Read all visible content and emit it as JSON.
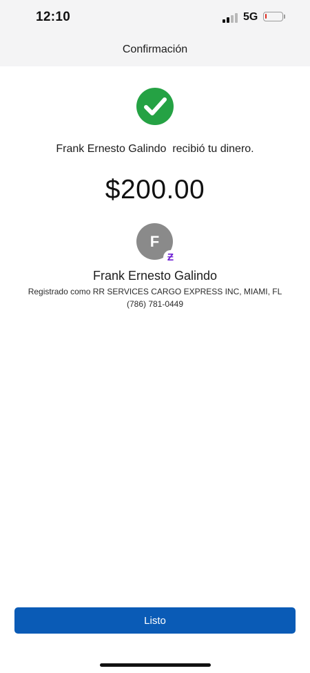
{
  "status_bar": {
    "time": "12:10",
    "network": "5G",
    "battery_level": 0.1,
    "signal_bars_active": 2,
    "battery_color": "#e0281d"
  },
  "header": {
    "title": "Confirmación"
  },
  "confirmation": {
    "success_icon": "check-circle-icon",
    "success_color": "#25a244",
    "message": "Frank Ernesto Galindo  recibió tu dinero.",
    "amount": "$200.00"
  },
  "recipient": {
    "avatar_initial": "F",
    "badge_icon": "zelle-icon",
    "badge_glyph": "Ƶ",
    "badge_color": "#6d1ed4",
    "name": "Frank Ernesto Galindo",
    "registered_as": "Registrado como RR SERVICES CARGO EXPRESS INC, MIAMI, FL",
    "phone": "(786) 781-0449"
  },
  "actions": {
    "done_label": "Listo",
    "button_color": "#0a5bb6"
  }
}
